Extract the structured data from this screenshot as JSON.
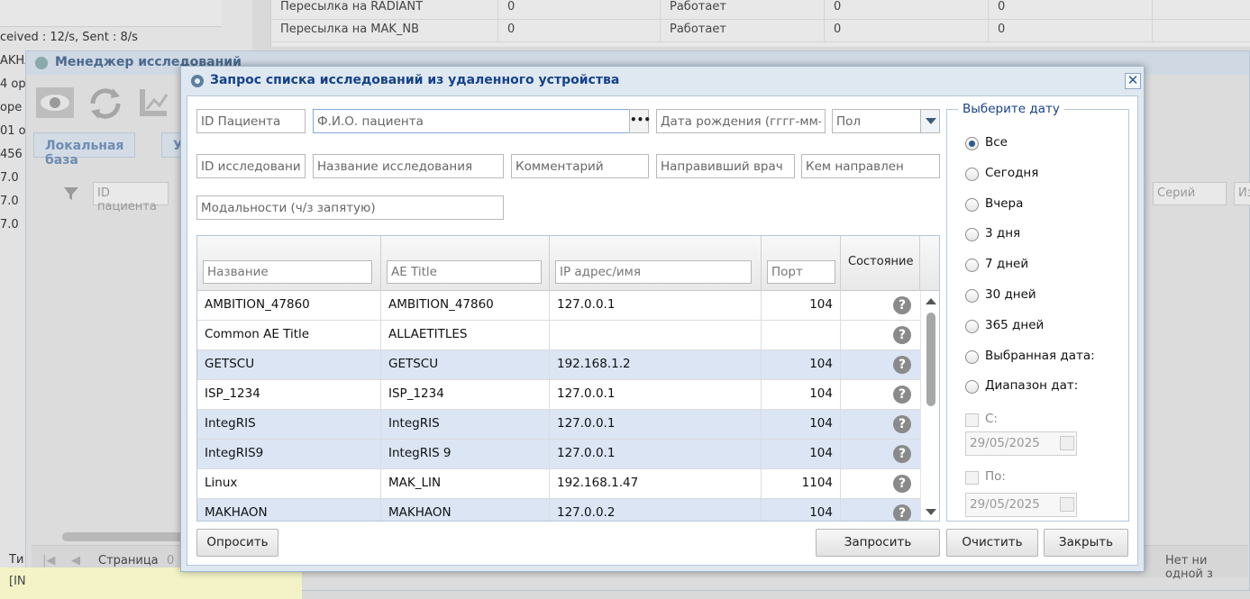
{
  "background": {
    "stats": "ceived : 12/s, Sent : 8/s",
    "left_fragments": [
      "AKHA",
      "4 op",
      " ope",
      "01 o",
      "456",
      "7.0",
      "7.0",
      "7.0"
    ],
    "top_table": [
      {
        "name": "Пересылка на RADIANT",
        "v1": "0",
        "status": "Работает",
        "v2": "0",
        "v3": "0"
      },
      {
        "name": "Пересылка на MAK_NB",
        "v1": "0",
        "status": "Работает",
        "v2": "0",
        "v3": "0"
      }
    ],
    "manager_title": "Менеджер исследований",
    "tab_local": "Локальная база",
    "tab_second": "У",
    "filter_patient": "ID пациента",
    "filter_series": "Серий",
    "filter_cut": "Из",
    "page_label": "Страница",
    "page_value": "0",
    "bottom_left": "Ти",
    "status_left": "[IN",
    "status_right": "Нет ни одной з"
  },
  "dialog": {
    "title": "Запрос списка исследований из удаленного устройства",
    "fields": {
      "patient_id": "ID Пациента",
      "patient_name": "Ф.И.О. пациента",
      "birth_date": "Дата рождения (гггг-мм-дд)",
      "sex": "Пол",
      "study_id": "ID исследования",
      "study_name": "Название исследования",
      "comment": "Комментарий",
      "referring_doctor": "Направивший врач",
      "referred_by": "Кем направлен",
      "modalities": "Модальности (ч/з запятую)"
    },
    "grid": {
      "filters": {
        "name": "Название",
        "ae_title": "AE Title",
        "ip": "IP адрес/имя",
        "port": "Порт"
      },
      "state_header": "Состояние",
      "rows": [
        {
          "name": "AMBITION_47860",
          "ae": "AMBITION_47860",
          "ip": "127.0.0.1",
          "port": "104"
        },
        {
          "name": "Common AE Title",
          "ae": "ALLAETITLES",
          "ip": "",
          "port": ""
        },
        {
          "name": "GETSCU",
          "ae": "GETSCU",
          "ip": "192.168.1.2",
          "port": "104"
        },
        {
          "name": "ISP_1234",
          "ae": "ISP_1234",
          "ip": "127.0.0.1",
          "port": "104"
        },
        {
          "name": "IntegRIS",
          "ae": "IntegRIS",
          "ip": "127.0.0.1",
          "port": "104"
        },
        {
          "name": "IntegRIS9",
          "ae": "IntegRIS 9",
          "ip": "127.0.0.1",
          "port": "104"
        },
        {
          "name": "Linux",
          "ae": "MAK_LIN",
          "ip": "192.168.1.47",
          "port": "1104"
        },
        {
          "name": "MAKHAON",
          "ae": "MAKHAON",
          "ip": "127.0.0.2",
          "port": "104"
        }
      ],
      "selected_rows": [
        2,
        4,
        5,
        7
      ],
      "state_glyph": "?"
    },
    "date_panel": {
      "legend": "Выберите дату",
      "options": [
        "Все",
        "Сегодня",
        "Вчера",
        "3 дня",
        "7 дней",
        "30 дней",
        "365 дней",
        "Выбранная дата:",
        "Диапазон дат:"
      ],
      "selected": "Все",
      "from_label": "С:",
      "to_label": "По:",
      "from_date": "29/05/2025",
      "to_date": "29/05/2025"
    },
    "buttons": {
      "poll": "Опросить",
      "request": "Запросить",
      "clear": "Очистить",
      "close": "Закрыть"
    },
    "close_glyph": "✕"
  }
}
